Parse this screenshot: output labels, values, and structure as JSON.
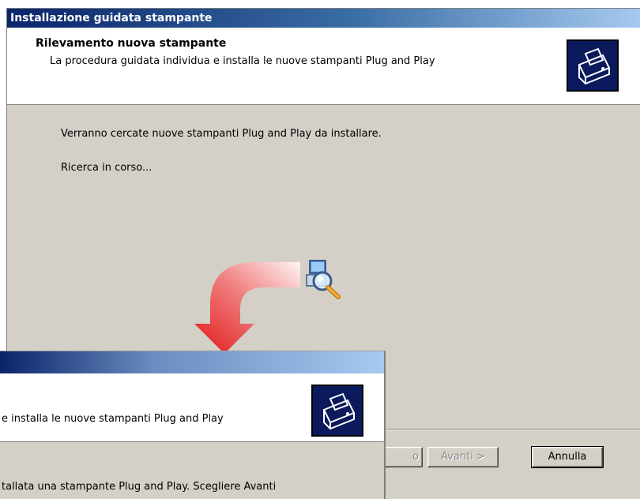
{
  "back_window": {
    "title": "Installazione guidata stampante",
    "header_title": "Rilevamento nuova stampante",
    "header_subtitle": "La procedura guidata individua e installa le nuove stampanti Plug and Play",
    "body_line1": "Verranno cercate nuove stampanti Plug and Play da installare.",
    "body_line2": "Ricerca in corso...",
    "buttons": {
      "back_partial": "o",
      "next": "Avanti >",
      "cancel": "Annulla"
    }
  },
  "front_window": {
    "header_subtitle_partial": "e installa le nuove stampanti Plug and Play",
    "body_partial": "tallata una stampante Plug and Play. Scegliere Avanti"
  },
  "icons": {
    "printer": "printer-icon",
    "search": "search-computer-icon",
    "arrow": "transition-arrow"
  },
  "colors": {
    "title_start": "#0a246a",
    "title_end": "#a6caf0",
    "dialog_bg": "#d4d0c8",
    "arrow": "#e02020"
  }
}
